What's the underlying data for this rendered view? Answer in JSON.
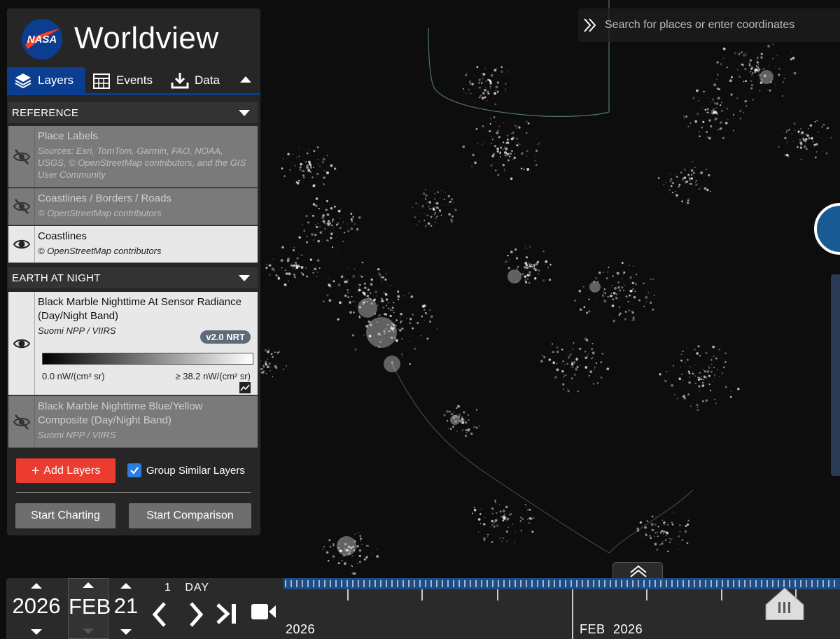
{
  "app": {
    "title": "Worldview",
    "logo_text": "NASA"
  },
  "tabs": [
    {
      "label": "Layers",
      "icon": "layers-icon",
      "active": true
    },
    {
      "label": "Events",
      "icon": "calendar-icon",
      "active": false
    },
    {
      "label": "Data",
      "icon": "download-icon",
      "active": false
    }
  ],
  "sections": [
    {
      "title": "REFERENCE"
    },
    {
      "title": "EARTH AT NIGHT"
    }
  ],
  "layers": {
    "place_labels": {
      "name": "Place Labels",
      "source": "Sources: Esri, TomTom, Garmin, FAO, NOAA, USGS, © OpenStreetMap contributors, and the GIS User Community",
      "visible": false
    },
    "coast_borders": {
      "name": "Coastlines / Borders / Roads",
      "source": "© OpenStreetMap contributors",
      "visible": false
    },
    "coastlines": {
      "name": "Coastlines",
      "source": "© OpenStreetMap contributors",
      "visible": true
    },
    "black_marble": {
      "name": "Black Marble Nighttime At Sensor Radiance (Day/Night Band)",
      "source": "Suomi NPP / VIIRS",
      "badge": "v2.0 NRT",
      "legend_min": "0.0 nW/(cm² sr)",
      "legend_max": "≥ 38.2 nW/(cm² sr)",
      "visible": true
    },
    "blue_yellow": {
      "name": "Black Marble Nighttime Blue/Yellow Composite (Day/Night Band)",
      "source": "Suomi NPP / VIIRS",
      "visible": false
    }
  },
  "actions": {
    "add_layers": "Add Layers",
    "group_similar": "Group Similar Layers",
    "group_similar_checked": true,
    "start_charting": "Start Charting",
    "start_comparison": "Start Comparison"
  },
  "search": {
    "placeholder": "Search for places or enter coordinates"
  },
  "timeline": {
    "year": "2026",
    "month": "FEB",
    "day": "21",
    "zoom_count": "1",
    "zoom_unit": "DAY",
    "axis_year_left": "2026",
    "axis_month": "FEB",
    "axis_year_right": "2026"
  },
  "colors": {
    "accent": "#0b3d91",
    "add_button": "#ec3b2f",
    "checkbox": "#2a7de1",
    "timeline_band": "#1e4d86"
  }
}
